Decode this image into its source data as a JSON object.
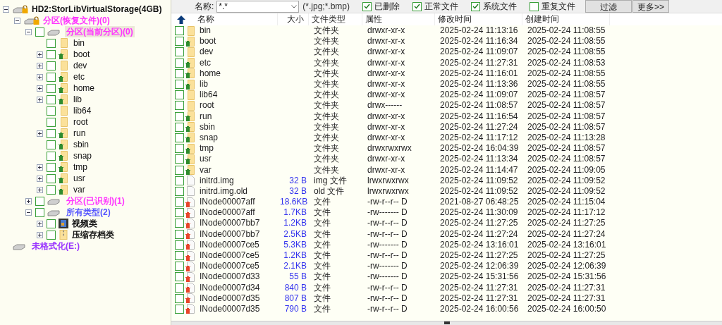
{
  "tree": [
    {
      "label": "HD2:StorLibVirtualStorage(4GB)",
      "kind": "disk",
      "expanded": true,
      "selected": false,
      "children": [
        {
          "label": "分区(恢复文件)(0)",
          "kind": "locked-partition",
          "expanded": true,
          "selected": false,
          "color": "#ff33ff",
          "children": [
            {
              "label": "分区(当前分区)(0)",
              "kind": "partition",
              "expanded": true,
              "checked": false,
              "selected": true,
              "color": "#ff33ff",
              "children": [
                {
                  "label": "bin",
                  "kind": "folder",
                  "deleted": false,
                  "checked": false,
                  "selected": false
                },
                {
                  "label": "boot",
                  "kind": "folder",
                  "deleted": true,
                  "expanded": false,
                  "checked": false,
                  "selected": false
                },
                {
                  "label": "dev",
                  "kind": "folder",
                  "deleted": false,
                  "expanded": false,
                  "checked": false,
                  "selected": false
                },
                {
                  "label": "etc",
                  "kind": "folder",
                  "deleted": true,
                  "expanded": false,
                  "checked": false,
                  "selected": false
                },
                {
                  "label": "home",
                  "kind": "folder",
                  "deleted": true,
                  "expanded": false,
                  "checked": false,
                  "selected": false
                },
                {
                  "label": "lib",
                  "kind": "folder",
                  "deleted": true,
                  "expanded": false,
                  "checked": false,
                  "selected": false
                },
                {
                  "label": "lib64",
                  "kind": "folder",
                  "deleted": false,
                  "checked": false,
                  "selected": false
                },
                {
                  "label": "root",
                  "kind": "folder",
                  "deleted": false,
                  "checked": false,
                  "selected": false
                },
                {
                  "label": "run",
                  "kind": "folder",
                  "deleted": true,
                  "expanded": false,
                  "checked": false,
                  "selected": false
                },
                {
                  "label": "sbin",
                  "kind": "folder",
                  "deleted": true,
                  "checked": false,
                  "selected": false
                },
                {
                  "label": "snap",
                  "kind": "folder",
                  "deleted": true,
                  "checked": false,
                  "selected": false
                },
                {
                  "label": "tmp",
                  "kind": "folder",
                  "deleted": true,
                  "expanded": false,
                  "checked": false,
                  "selected": false
                },
                {
                  "label": "usr",
                  "kind": "folder",
                  "deleted": true,
                  "expanded": false,
                  "checked": false,
                  "selected": false
                },
                {
                  "label": "var",
                  "kind": "folder",
                  "deleted": true,
                  "expanded": false,
                  "checked": false,
                  "selected": false
                }
              ]
            },
            {
              "label": "分区(已识别)(1)",
              "kind": "partition",
              "expanded": false,
              "checked": false,
              "selected": false,
              "color": "#ff33ff"
            },
            {
              "label": "所有类型(2)",
              "kind": "partition",
              "expanded": true,
              "checked": false,
              "selected": false,
              "color": "#5555ff",
              "children": [
                {
                  "label": "视频类",
                  "kind": "video-category",
                  "expanded": false,
                  "checked": false,
                  "selected": false
                },
                {
                  "label": "压缩存档类",
                  "kind": "archive-category",
                  "expanded": false,
                  "checked": false,
                  "selected": false
                }
              ]
            }
          ]
        }
      ]
    },
    {
      "label": "未格式化(E:)",
      "kind": "unformatted",
      "selected": false,
      "color": "#9933ff"
    }
  ],
  "filter": {
    "name_label": "名称:",
    "name_value": "*.*",
    "hint": "(*.jpg;*.bmp)",
    "options": [
      {
        "label": "已删除",
        "checked": true
      },
      {
        "label": "正常文件",
        "checked": true
      },
      {
        "label": "系统文件",
        "checked": true
      },
      {
        "label": "重复文件",
        "checked": false
      }
    ],
    "buttons": [
      "过滤",
      "更多>>"
    ]
  },
  "table": {
    "columns": [
      "名称",
      "大小",
      "文件类型",
      "属性",
      "修改时间",
      "创建时间"
    ],
    "rows": [
      {
        "kind": "folder",
        "deleted": false,
        "checked": false,
        "name": "bin",
        "size": "",
        "type": "文件夹",
        "attr": "drwxr-xr-x",
        "mtime": "2025-02-24 11:13:16",
        "ctime": "2025-02-24 11:08:55"
      },
      {
        "kind": "folder",
        "deleted": true,
        "checked": false,
        "name": "boot",
        "size": "",
        "type": "文件夹",
        "attr": "drwxr-xr-x",
        "mtime": "2025-02-24 11:16:34",
        "ctime": "2025-02-24 11:08:55"
      },
      {
        "kind": "folder",
        "deleted": false,
        "checked": false,
        "name": "dev",
        "size": "",
        "type": "文件夹",
        "attr": "drwxr-xr-x",
        "mtime": "2025-02-24 11:09:07",
        "ctime": "2025-02-24 11:08:55"
      },
      {
        "kind": "folder",
        "deleted": true,
        "checked": false,
        "name": "etc",
        "size": "",
        "type": "文件夹",
        "attr": "drwxr-xr-x",
        "mtime": "2025-02-24 11:27:31",
        "ctime": "2025-02-24 11:08:53"
      },
      {
        "kind": "folder",
        "deleted": true,
        "checked": false,
        "name": "home",
        "size": "",
        "type": "文件夹",
        "attr": "drwxr-xr-x",
        "mtime": "2025-02-24 11:16:01",
        "ctime": "2025-02-24 11:08:55"
      },
      {
        "kind": "folder",
        "deleted": true,
        "checked": false,
        "name": "lib",
        "size": "",
        "type": "文件夹",
        "attr": "drwxr-xr-x",
        "mtime": "2025-02-24 11:13:36",
        "ctime": "2025-02-24 11:08:55"
      },
      {
        "kind": "folder",
        "deleted": false,
        "checked": false,
        "name": "lib64",
        "size": "",
        "type": "文件夹",
        "attr": "drwxr-xr-x",
        "mtime": "2025-02-24 11:09:07",
        "ctime": "2025-02-24 11:08:57"
      },
      {
        "kind": "folder",
        "deleted": false,
        "checked": false,
        "name": "root",
        "size": "",
        "type": "文件夹",
        "attr": "drwx------",
        "mtime": "2025-02-24 11:08:57",
        "ctime": "2025-02-24 11:08:57"
      },
      {
        "kind": "folder",
        "deleted": true,
        "checked": false,
        "name": "run",
        "size": "",
        "type": "文件夹",
        "attr": "drwxr-xr-x",
        "mtime": "2025-02-24 11:16:54",
        "ctime": "2025-02-24 11:08:57"
      },
      {
        "kind": "folder",
        "deleted": true,
        "checked": false,
        "name": "sbin",
        "size": "",
        "type": "文件夹",
        "attr": "drwxr-xr-x",
        "mtime": "2025-02-24 11:27:24",
        "ctime": "2025-02-24 11:08:57"
      },
      {
        "kind": "folder",
        "deleted": true,
        "checked": false,
        "name": "snap",
        "size": "",
        "type": "文件夹",
        "attr": "drwxr-xr-x",
        "mtime": "2025-02-24 11:17:12",
        "ctime": "2025-02-24 11:13:28"
      },
      {
        "kind": "folder",
        "deleted": true,
        "checked": false,
        "name": "tmp",
        "size": "",
        "type": "文件夹",
        "attr": "drwxrwxrwx",
        "mtime": "2025-02-24 16:04:39",
        "ctime": "2025-02-24 11:08:57"
      },
      {
        "kind": "folder",
        "deleted": true,
        "checked": false,
        "name": "usr",
        "size": "",
        "type": "文件夹",
        "attr": "drwxr-xr-x",
        "mtime": "2025-02-24 11:13:34",
        "ctime": "2025-02-24 11:08:57"
      },
      {
        "kind": "folder",
        "deleted": true,
        "checked": false,
        "name": "var",
        "size": "",
        "type": "文件夹",
        "attr": "drwxr-xr-x",
        "mtime": "2025-02-24 11:14:47",
        "ctime": "2025-02-24 11:09:05"
      },
      {
        "kind": "file",
        "deleted": false,
        "checked": false,
        "name": "initrd.img",
        "size": "32 B",
        "type": "img 文件",
        "attr": "lrwxrwxrwx",
        "mtime": "2025-02-24 11:09:52",
        "ctime": "2025-02-24 11:09:52"
      },
      {
        "kind": "file",
        "deleted": false,
        "checked": false,
        "name": "initrd.img.old",
        "size": "32 B",
        "type": "old 文件",
        "attr": "lrwxrwxrwx",
        "mtime": "2025-02-24 11:09:52",
        "ctime": "2025-02-24 11:09:52"
      },
      {
        "kind": "file",
        "deleted": true,
        "checked": false,
        "name": "INode00007aff",
        "size": "18.6KB",
        "type": "文件",
        "attr": "-rw-r--r-- D",
        "mtime": "2021-08-27 06:48:25",
        "ctime": "2025-02-24 11:15:04"
      },
      {
        "kind": "file",
        "deleted": true,
        "checked": false,
        "name": "INode00007aff",
        "size": "1.7KB",
        "type": "文件",
        "attr": "-rw------- D",
        "mtime": "2025-02-24 11:30:09",
        "ctime": "2025-02-24 11:17:12"
      },
      {
        "kind": "file",
        "deleted": true,
        "checked": false,
        "name": "INode00007bb7",
        "size": "1.2KB",
        "type": "文件",
        "attr": "-rw-r--r-- D",
        "mtime": "2025-02-24 11:27:25",
        "ctime": "2025-02-24 11:27:25"
      },
      {
        "kind": "file",
        "deleted": true,
        "checked": false,
        "name": "INode00007bb7",
        "size": "2.5KB",
        "type": "文件",
        "attr": "-rw-r--r-- D",
        "mtime": "2025-02-24 11:27:24",
        "ctime": "2025-02-24 11:27:24"
      },
      {
        "kind": "file",
        "deleted": true,
        "checked": false,
        "name": "INode00007ce5",
        "size": "5.3KB",
        "type": "文件",
        "attr": "-rw------- D",
        "mtime": "2025-02-24 13:16:01",
        "ctime": "2025-02-24 13:16:01"
      },
      {
        "kind": "file",
        "deleted": true,
        "checked": false,
        "name": "INode00007ce5",
        "size": "1.2KB",
        "type": "文件",
        "attr": "-rw-r--r-- D",
        "mtime": "2025-02-24 11:27:25",
        "ctime": "2025-02-24 11:27:25"
      },
      {
        "kind": "file",
        "deleted": true,
        "checked": false,
        "name": "INode00007ce5",
        "size": "2.1KB",
        "type": "文件",
        "attr": "-rw------- D",
        "mtime": "2025-02-24 12:06:39",
        "ctime": "2025-02-24 12:06:39"
      },
      {
        "kind": "file",
        "deleted": true,
        "checked": false,
        "name": "INode00007d33",
        "size": "55 B",
        "type": "文件",
        "attr": "-rw------- D",
        "mtime": "2025-02-24 15:31:56",
        "ctime": "2025-02-24 15:31:56"
      },
      {
        "kind": "file",
        "deleted": true,
        "checked": false,
        "name": "INode00007d34",
        "size": "840 B",
        "type": "文件",
        "attr": "-rw-r--r-- D",
        "mtime": "2025-02-24 11:27:31",
        "ctime": "2025-02-24 11:27:31"
      },
      {
        "kind": "file",
        "deleted": true,
        "checked": false,
        "name": "INode00007d35",
        "size": "807 B",
        "type": "文件",
        "attr": "-rw-r--r-- D",
        "mtime": "2025-02-24 11:27:31",
        "ctime": "2025-02-24 11:27:31"
      },
      {
        "kind": "file",
        "deleted": true,
        "checked": false,
        "name": "INode00007d35",
        "size": "790 B",
        "type": "文件",
        "attr": "-rw-r--r-- D",
        "mtime": "2025-02-24 16:00:56",
        "ctime": "2025-02-24 16:00:50"
      }
    ]
  }
}
